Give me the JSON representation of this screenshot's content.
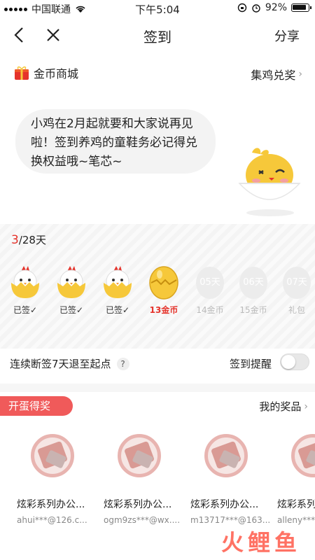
{
  "status_bar": {
    "carrier": "中国联通",
    "time": "下午5:04",
    "battery": "92%"
  },
  "nav": {
    "title": "签到",
    "share": "分享"
  },
  "mall": {
    "label": "金币商城",
    "exchange": "集鸡兑奖"
  },
  "bubble": {
    "text": "小鸡在2月起就要和大家说再见啦！签到养鸡的童鞋务必记得兑换权益哦~笔芯~"
  },
  "progress": {
    "current": "3",
    "total": "/28天"
  },
  "days": [
    {
      "label": "已签✓",
      "state": "done"
    },
    {
      "label": "已签✓",
      "state": "done"
    },
    {
      "label": "已签✓",
      "state": "done"
    },
    {
      "label": "13金币",
      "state": "today"
    },
    {
      "label": "14金币",
      "state": "future",
      "egg_text": "05天"
    },
    {
      "label": "15金币",
      "state": "future",
      "egg_text": "06天"
    },
    {
      "label": "礼包",
      "state": "future",
      "egg_text": "07天"
    }
  ],
  "reminder": {
    "rule": "连续断签7天退至起点",
    "help": "?",
    "label": "签到提醒"
  },
  "prizes_section": {
    "tag": "开蛋得奖",
    "my_prizes": "我的奖品"
  },
  "prizes": [
    {
      "name": "炫彩系列办公...",
      "user": "ahui***@126.c..."
    },
    {
      "name": "炫彩系列办公...",
      "user": "ogm9zs***@wx...."
    },
    {
      "name": "炫彩系列办公...",
      "user": "m13717***@163..."
    },
    {
      "name": "炫彩系列办公...",
      "user": "alleny***@"
    }
  ],
  "watermark": "火鲤鱼",
  "colors": {
    "accent": "#e5332b",
    "tag": "#f05a5a",
    "egg": "#f6c83a"
  }
}
